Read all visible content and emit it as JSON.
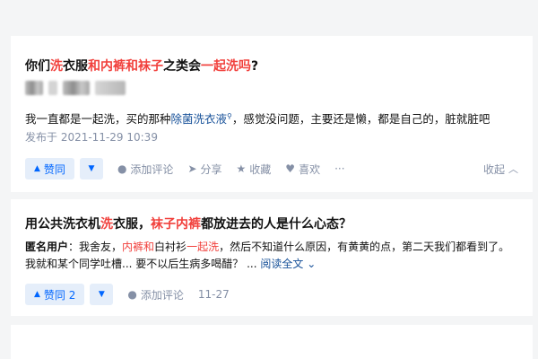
{
  "answer1": {
    "title": [
      "你们",
      "洗",
      "衣服",
      "和内裤和袜子",
      "之类会",
      "一起洗吗",
      "?"
    ],
    "content_pre": "我一直都是一起洗，买的那种",
    "content_link": "除菌洗衣液",
    "content_post": "，感觉没问题，主要还是懒，都是自己的，脏就脏吧",
    "date": "发布于 2021-11-29 10:39",
    "vote_up_label": "赞同",
    "actions": {
      "comment": "添加评论",
      "share": "分享",
      "favorite": "收藏",
      "like": "喜欢",
      "more": "···",
      "collapse": "收起"
    }
  },
  "answer2": {
    "title": [
      "用公共洗衣机",
      "洗",
      "衣服，",
      "袜子内裤",
      "都放进去的人是什么心态？"
    ],
    "author": "匿名用户",
    "excerpt_a": "：我舍友，",
    "excerpt_hl1": "内裤和",
    "excerpt_b": "白衬衫",
    "excerpt_hl2": "一起洗",
    "excerpt_c": "，然后不知道什么原因，有黄黄的点，第二天我们都看到了。我就和某个同学吐槽... 要不以后生病多喝醋？ ...",
    "read_more": "阅读全文",
    "vote_up_label": "赞同 2",
    "comment": "添加评论",
    "date": "11-27"
  },
  "icons": {
    "vote_up": "triangle-up-icon",
    "vote_down": "triangle-down-icon",
    "comment": "comment-icon",
    "share": "share-icon",
    "favorite": "star-icon",
    "like": "heart-icon",
    "collapse": "chevron-up-icon",
    "read_more": "chevron-down-icon"
  },
  "colors": {
    "highlight": "#f1403c",
    "link": "#175199",
    "vote_bg": "#e5eefa",
    "vote_text": "#0066ff",
    "meta": "#8590a6"
  }
}
